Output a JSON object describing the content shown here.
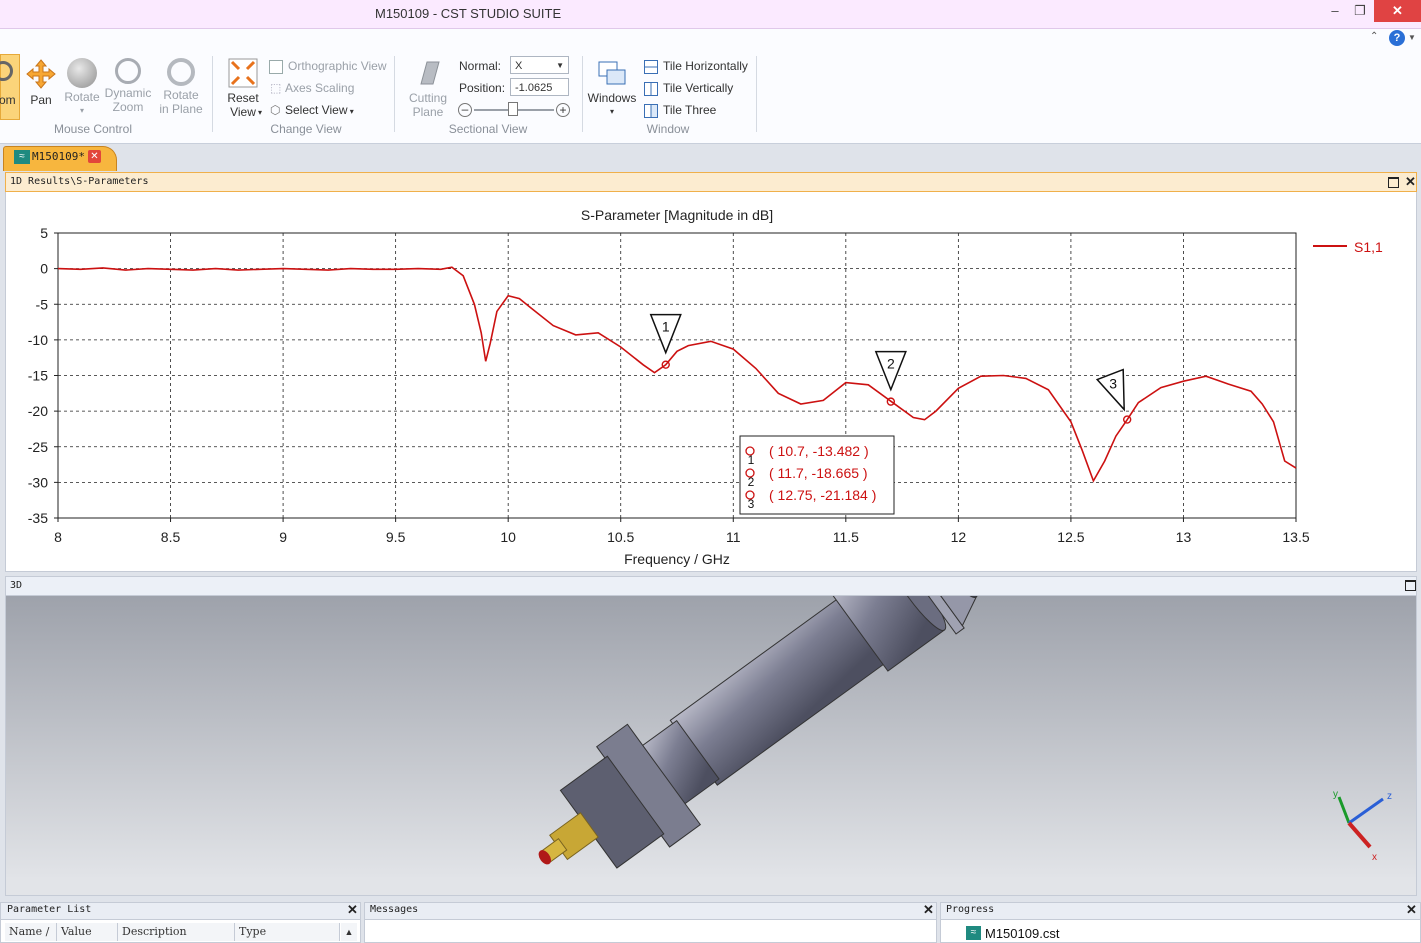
{
  "window": {
    "title": "M150109 - CST STUDIO SUITE",
    "controls": [
      "–",
      "❐",
      "✕"
    ]
  },
  "ribbon": {
    "groups": {
      "mouse_control": {
        "label": "Mouse Control",
        "buttons": [
          {
            "label": "om",
            "icon": "zoom-icon",
            "active": true
          },
          {
            "label": "Pan",
            "icon": "pan-icon"
          },
          {
            "label": "Rotate",
            "icon": "rotate-icon",
            "disabled": true
          },
          {
            "label": "Dynamic\nZoom",
            "icon": "dynamic-zoom-icon",
            "disabled": true
          },
          {
            "label": "Rotate\nin Plane",
            "icon": "rotate-in-plane-icon",
            "disabled": true
          }
        ]
      },
      "change_view": {
        "label": "Change View",
        "reset_view": "Reset\nView",
        "orthographic": "Orthographic View",
        "axes_scaling": "Axes Scaling",
        "select_view": "Select View"
      },
      "sectional_view": {
        "label": "Sectional View",
        "cutting_plane": "Cutting\nPlane",
        "normal_label": "Normal:",
        "normal_value": "X",
        "position_label": "Position:",
        "position_value": "-1.0625"
      },
      "window": {
        "label": "Window",
        "windows": "Windows",
        "tile_h": "Tile Horizontally",
        "tile_v": "Tile Vertically",
        "tile_three": "Tile Three"
      }
    }
  },
  "document_tab": {
    "label": "M150109*"
  },
  "results_panel": {
    "title": "1D Results\\S-Parameters"
  },
  "view3d_panel": {
    "title": "3D"
  },
  "chart_data": {
    "type": "line",
    "title": "S-Parameter [Magnitude in dB]",
    "xlabel": "Frequency / GHz",
    "ylabel": "",
    "xlim": [
      8,
      13.5
    ],
    "ylim": [
      -35,
      5
    ],
    "xticks": [
      "8",
      "8.5",
      "9",
      "9.5",
      "10",
      "10.5",
      "11",
      "11.5",
      "12",
      "12.5",
      "13",
      "13.5"
    ],
    "yticks": [
      "5",
      "0",
      "-5",
      "-10",
      "-15",
      "-20",
      "-25",
      "-30",
      "-35"
    ],
    "grid": true,
    "legend_position": "right",
    "series": [
      {
        "name": "S1,1",
        "color": "#cc1111",
        "x": [
          8.0,
          8.1,
          8.2,
          8.3,
          8.4,
          8.5,
          8.6,
          8.7,
          8.8,
          8.9,
          9.0,
          9.1,
          9.2,
          9.3,
          9.4,
          9.5,
          9.6,
          9.7,
          9.75,
          9.8,
          9.85,
          9.88,
          9.9,
          9.92,
          9.95,
          10.0,
          10.05,
          10.1,
          10.2,
          10.3,
          10.4,
          10.5,
          10.6,
          10.65,
          10.7,
          10.75,
          10.8,
          10.9,
          11.0,
          11.1,
          11.2,
          11.3,
          11.4,
          11.5,
          11.6,
          11.7,
          11.8,
          11.85,
          11.9,
          12.0,
          12.1,
          12.2,
          12.3,
          12.4,
          12.5,
          12.55,
          12.6,
          12.65,
          12.7,
          12.75,
          12.8,
          12.9,
          13.0,
          13.1,
          13.2,
          13.3,
          13.35,
          13.4,
          13.45,
          13.5
        ],
        "y": [
          0.0,
          -0.1,
          0.1,
          -0.2,
          0.0,
          -0.1,
          -0.2,
          0.0,
          -0.2,
          -0.1,
          0.0,
          -0.1,
          -0.2,
          0.0,
          -0.1,
          -0.1,
          0.0,
          -0.1,
          0.2,
          -1.0,
          -5.0,
          -9.0,
          -13.0,
          -10.5,
          -6.0,
          -3.8,
          -4.2,
          -5.5,
          -8.0,
          -9.3,
          -9.0,
          -11.0,
          -13.5,
          -14.6,
          -13.5,
          -11.6,
          -10.8,
          -10.2,
          -11.3,
          -14.0,
          -17.5,
          -19.0,
          -18.5,
          -16.0,
          -16.3,
          -18.6,
          -20.9,
          -21.2,
          -20.0,
          -16.8,
          -15.1,
          -15.0,
          -15.4,
          -17.0,
          -21.5,
          -25.5,
          -29.8,
          -27.0,
          -23.5,
          -21.2,
          -18.8,
          -16.7,
          -15.8,
          -15.1,
          -16.2,
          -17.2,
          -19.0,
          -21.5,
          -27.0,
          -28.0
        ]
      }
    ],
    "markers": [
      {
        "id": "1",
        "x": 10.7,
        "y": -13.482,
        "label": "( 10.7, -13.482 )"
      },
      {
        "id": "2",
        "x": 11.7,
        "y": -18.665,
        "label": "( 11.7, -18.665 )"
      },
      {
        "id": "3",
        "x": 12.75,
        "y": -21.184,
        "label": "( 12.75, -21.184 )"
      }
    ]
  },
  "axes_gizmo": {
    "x": "x",
    "y": "y",
    "z": "z"
  },
  "bottom_panels": {
    "parameter_list": {
      "title": "Parameter List",
      "columns": [
        "Name /",
        "Value",
        "Description",
        "Type"
      ]
    },
    "messages": {
      "title": "Messages"
    },
    "progress": {
      "title": "Progress",
      "item": "M150109.cst"
    }
  }
}
